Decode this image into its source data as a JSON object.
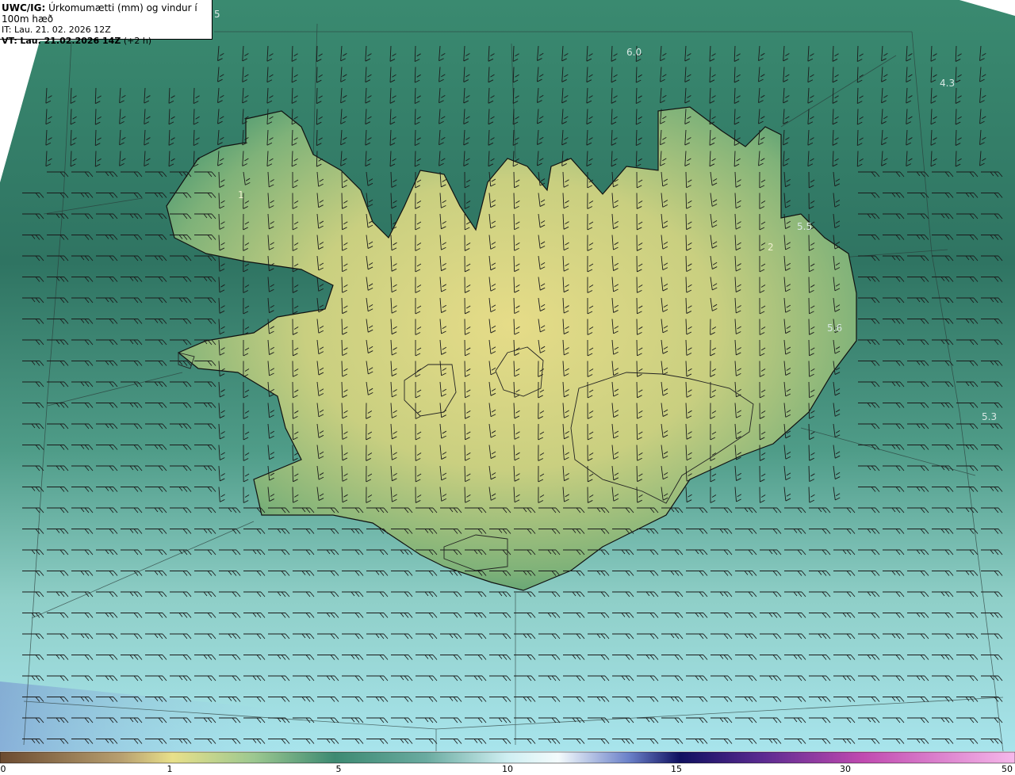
{
  "header": {
    "model": "UWC/IG:",
    "title": "Úrkomumætti (mm) og vindur í 100m hæð",
    "it_label": "IT:",
    "it_value": "Lau. 21. 02. 2026 12Z",
    "vt_label": "VT:",
    "vt_value": "Lau. 21.02.2026 14Z",
    "vt_offset": "(+2 h)"
  },
  "value_labels": [
    {
      "text": "6.0"
    },
    {
      "text": "4.3"
    },
    {
      "text": "5.5"
    },
    {
      "text": "5.6"
    },
    {
      "text": "5"
    },
    {
      "text": "2"
    },
    {
      "text": "1"
    },
    {
      "text": "5.3"
    }
  ],
  "colorbar": {
    "ticks": [
      "0",
      "1",
      "5",
      "10",
      "15",
      "30",
      "50"
    ],
    "colors": [
      "#7a5a3a",
      "#b59a60",
      "#e8e08a",
      "#8fbf90",
      "#3d8a72",
      "#6aaba0",
      "#bfe8ec",
      "#e8f8fa",
      "#2a2a8a",
      "#6a2a8a",
      "#c04ab0",
      "#f0a0e0"
    ]
  },
  "colors": {
    "sea_north": "#2f7a66",
    "sea_south": "#8fd3d5",
    "land_high": "#e8e08a",
    "land_low": "#5aa070"
  }
}
